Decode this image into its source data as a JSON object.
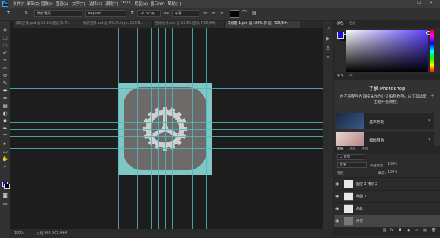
{
  "menubar": {
    "logo": "Ps",
    "items": [
      "文件(F)",
      "编辑(E)",
      "图像(I)",
      "图层(L)",
      "文字(Y)",
      "选择(S)",
      "滤镜(T)",
      "3D(D)",
      "视图(V)",
      "窗口(W)",
      "帮助(H)"
    ],
    "controls": [
      "—",
      "☐",
      "✕"
    ]
  },
  "options": {
    "tool_glyph": "T",
    "orient_glyph": "⇅",
    "font_family": "微软雅黑",
    "font_style": "Regular",
    "size_glyph": "T",
    "font_size": "26.67 点",
    "aa_label": "aa",
    "aa_value": "平滑",
    "color": "#000000"
  },
  "tabs": [
    {
      "label": "微软启蒙.psd @ 33.3%(图层 5, R…",
      "active": false
    },
    {
      "label": "微软宣传.psd @ 34.2%(logo, RGB/8…",
      "active": false
    },
    {
      "label": "图标设计.psd @ 33.3%(图标, RGB/8#)",
      "active": false
    },
    {
      "label": "未标题-1.psd @ 100% (外层, RGB/8#)",
      "active": true
    }
  ],
  "tools": [
    "✥",
    "⬚",
    "◌",
    "✐",
    "⌗",
    "✂",
    "⊘",
    "✎",
    "✚",
    "♒",
    "▦",
    "◐",
    "⬮",
    "✒",
    "T",
    "▸",
    "▭",
    "✋",
    "⌕",
    "…"
  ],
  "status": {
    "zoom": "100%",
    "doc": "文档:908.8K/2.44M"
  },
  "color_panel": {
    "tabs": [
      "颜色",
      "色板"
    ]
  },
  "learn_panel": {
    "tabs": [
      "学习",
      "库"
    ],
    "title": "了解 Photoshop",
    "desc": "在应用程序内直接操作的分步指导教程。从下面选取一个主题开始教程。",
    "cards": [
      {
        "label": "基本技能",
        "arrow": "›"
      },
      {
        "label": "修饰照片",
        "arrow": "›"
      }
    ]
  },
  "layers_panel": {
    "tabs": [
      "图层",
      "通道",
      "路径"
    ],
    "filter": "Q 类型",
    "blend_mode": "正常",
    "opacity_label": "不透明度:",
    "opacity": "100%",
    "lock_label": "锁定:",
    "fill_label": "填充:",
    "fill": "100%",
    "layers": [
      {
        "name": "图层 1 拷贝 2",
        "selected": false
      },
      {
        "name": "椭圆 1",
        "selected": false
      },
      {
        "name": "齿轮",
        "selected": false
      },
      {
        "name": "外层",
        "selected": true
      }
    ],
    "footer_icons": [
      "⛓",
      "fx",
      "◘",
      "◑",
      "▭",
      "▤",
      "🗑"
    ]
  },
  "colors": {
    "accent_guide": "#4fb8bc",
    "doc_background": "#7fc6c4",
    "icon_fill": "#6e6a6a",
    "gear": "#cfcfcf",
    "foreground": "#1a0bdc"
  }
}
